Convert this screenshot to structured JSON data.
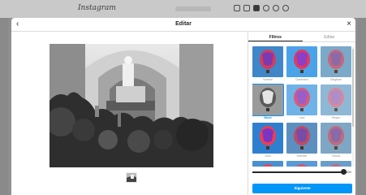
{
  "topbar": {
    "logo": "Instagram",
    "icons": [
      "home-icon",
      "direct-icon",
      "new-post-icon",
      "explore-icon",
      "activity-icon",
      "profile-icon"
    ]
  },
  "modal": {
    "title": "Editar",
    "back_icon": "chevron-left-icon",
    "close_icon": "close-icon"
  },
  "tabs": [
    {
      "label": "Filtros",
      "active": true
    },
    {
      "label": "Editar",
      "active": false
    }
  ],
  "filters": [
    {
      "name": "Normal",
      "selected": false
    },
    {
      "name": "Clarendon",
      "selected": false
    },
    {
      "name": "Gingham",
      "selected": false
    },
    {
      "name": "Moon",
      "selected": true
    },
    {
      "name": "Lark",
      "selected": false
    },
    {
      "name": "Reyes",
      "selected": false
    },
    {
      "name": "Juno",
      "selected": false
    },
    {
      "name": "Slumber",
      "selected": false
    },
    {
      "name": "Crema",
      "selected": false
    },
    {
      "name": "",
      "selected": false
    },
    {
      "name": "",
      "selected": false
    },
    {
      "name": "",
      "selected": false
    }
  ],
  "intensity": {
    "value": 100,
    "max": 100,
    "label": "100"
  },
  "next_label": "Siguiente",
  "colors": {
    "accent": "#0095f6",
    "selected_text": "#0095f6"
  }
}
